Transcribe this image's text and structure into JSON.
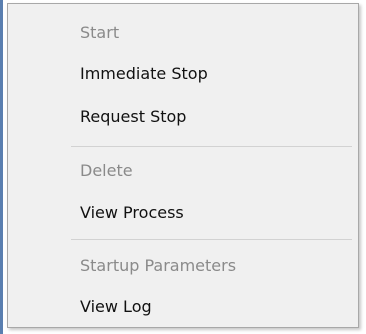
{
  "context_menu": {
    "items": [
      {
        "label": "Start",
        "enabled": false
      },
      {
        "label": "Immediate Stop",
        "enabled": true
      },
      {
        "label": "Request Stop",
        "enabled": true
      },
      {
        "label": "Delete",
        "enabled": false
      },
      {
        "label": "View Process",
        "enabled": true
      },
      {
        "label": "Startup Parameters",
        "enabled": false
      },
      {
        "label": "View Log",
        "enabled": true
      }
    ]
  },
  "colors": {
    "menu_background": "#f0f0f0",
    "enabled_text": "#111111",
    "disabled_text": "#8a8a8a",
    "separator": "#d2d2d2",
    "window_edge": "#5a7fb0"
  }
}
